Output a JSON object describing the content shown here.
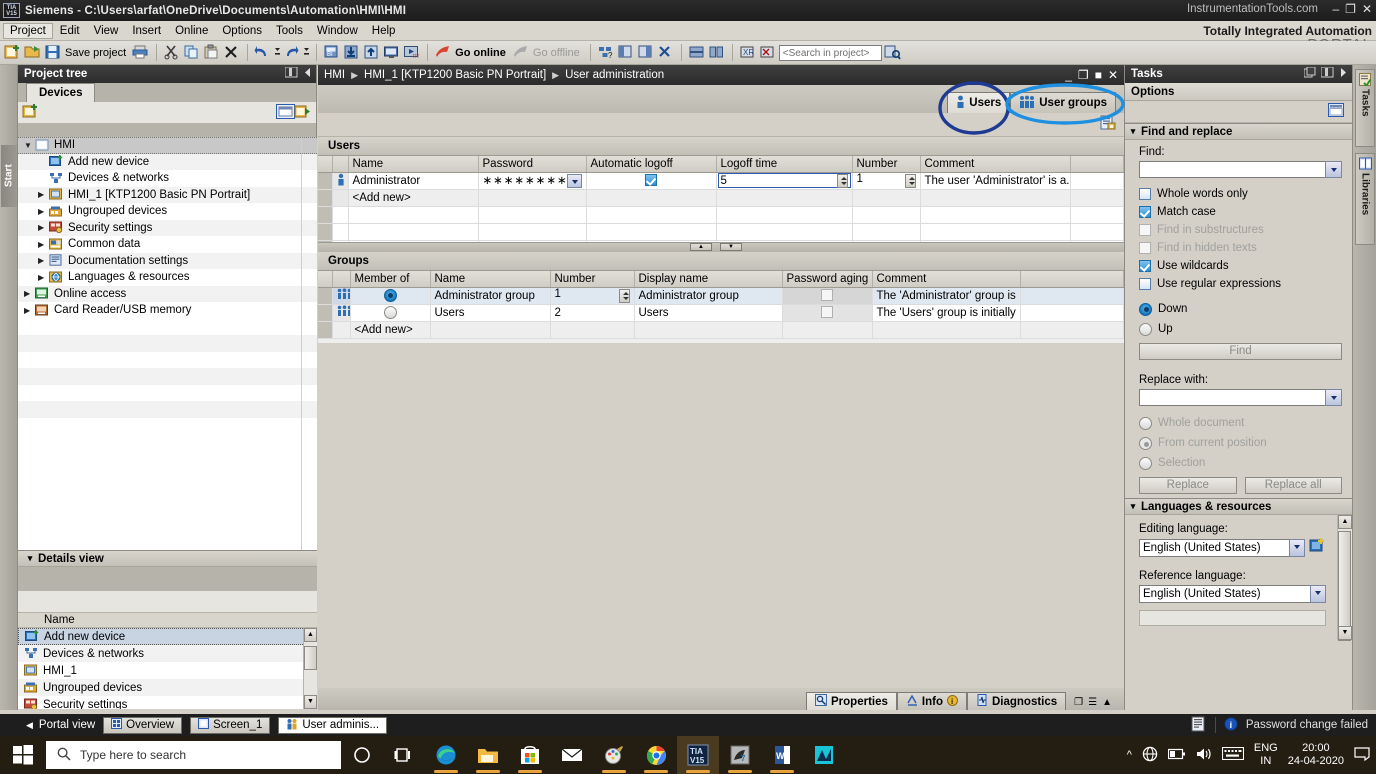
{
  "titlebar": {
    "app_title": "Siemens  -  C:\\Users\\arfat\\OneDrive\\Documents\\Automation\\HMI\\HMI",
    "watermark": "InstrumentationTools.com",
    "minimize": "–",
    "restore": "❐",
    "close": "✕"
  },
  "menu": {
    "items": [
      "Project",
      "Edit",
      "View",
      "Insert",
      "Online",
      "Options",
      "Tools",
      "Window",
      "Help"
    ]
  },
  "branding": {
    "line1": "Totally Integrated Automation",
    "line2": "PORTAL"
  },
  "toolbar": {
    "save_project": "Save project",
    "go_online": "Go online",
    "go_offline": "Go offline",
    "search_placeholder": "<Search in project>"
  },
  "left_strip": {
    "start_tab": "Start"
  },
  "project_tree": {
    "title": "Project tree",
    "tab": "Devices",
    "nodes": [
      {
        "label": "HMI",
        "indent": 0,
        "arrow": "open",
        "icon": "folder-icon",
        "selected": true
      },
      {
        "label": "Add new device",
        "indent": 1,
        "arrow": "none",
        "icon": "add-device-icon",
        "selected": false
      },
      {
        "label": "Devices & networks",
        "indent": 1,
        "arrow": "none",
        "icon": "network-icon",
        "selected": false
      },
      {
        "label": "HMI_1 [KTP1200 Basic PN Portrait]",
        "indent": 1,
        "arrow": "closed",
        "icon": "hmi-device-icon",
        "selected": false
      },
      {
        "label": "Ungrouped devices",
        "indent": 1,
        "arrow": "closed",
        "icon": "ungrouped-icon",
        "selected": false
      },
      {
        "label": "Security settings",
        "indent": 1,
        "arrow": "closed",
        "icon": "security-icon",
        "selected": false
      },
      {
        "label": "Common data",
        "indent": 1,
        "arrow": "closed",
        "icon": "common-data-icon",
        "selected": false
      },
      {
        "label": "Documentation settings",
        "indent": 1,
        "arrow": "closed",
        "icon": "documentation-icon",
        "selected": false
      },
      {
        "label": "Languages & resources",
        "indent": 1,
        "arrow": "closed",
        "icon": "languages-icon",
        "selected": false
      },
      {
        "label": "Online access",
        "indent": 0,
        "arrow": "closed",
        "icon": "online-access-icon",
        "selected": false
      },
      {
        "label": "Card Reader/USB memory",
        "indent": 0,
        "arrow": "closed",
        "icon": "card-reader-icon",
        "selected": false
      }
    ]
  },
  "details_view": {
    "title": "Details view",
    "column_header": "Name",
    "rows": [
      {
        "label": "Add new device",
        "icon": "add-device-icon",
        "selected": true
      },
      {
        "label": "Devices & networks",
        "icon": "network-icon",
        "selected": false
      },
      {
        "label": "HMI_1",
        "icon": "hmi-device-icon",
        "selected": false
      },
      {
        "label": "Ungrouped devices",
        "icon": "ungrouped-icon",
        "selected": false
      },
      {
        "label": "Security settings",
        "icon": "security-icon",
        "selected": false
      }
    ]
  },
  "editor": {
    "breadcrumb": [
      "HMI",
      "HMI_1 [KTP1200 Basic PN Portrait]",
      "User administration"
    ],
    "tabs": [
      {
        "label": "Users",
        "icon": "single-user-icon",
        "active": true
      },
      {
        "label": "User groups",
        "icon": "group-users-icon",
        "active": false
      }
    ],
    "users_section": {
      "title": "Users",
      "columns": [
        "Name",
        "Password",
        "Automatic logoff",
        "Logoff time",
        "Number",
        "Comment"
      ],
      "rows": [
        {
          "name": "Administrator",
          "password": "∗∗∗∗∗∗∗∗",
          "automatic_logoff": true,
          "logoff_time": "5",
          "number": "1",
          "comment": "The user 'Administrator' is a..."
        }
      ],
      "add_new": "<Add new>"
    },
    "groups_section": {
      "title": "Groups",
      "columns": [
        "Member of",
        "Name",
        "Number",
        "Display name",
        "Password aging",
        "Comment"
      ],
      "rows": [
        {
          "member_of": true,
          "name": "Administrator group",
          "number": "1",
          "display_name": "Administrator group",
          "password_aging": false,
          "comment": "The 'Administrator' group is ..."
        },
        {
          "member_of": false,
          "name": "Users",
          "number": "2",
          "display_name": "Users",
          "password_aging": false,
          "comment": "The 'Users' group is initially ..."
        }
      ],
      "add_new": "<Add new>"
    },
    "bottom_tabs": [
      {
        "label": "Properties",
        "icon": "properties-icon",
        "active": true
      },
      {
        "label": "Info",
        "icon": "info-icon",
        "active": false,
        "badge": "i"
      },
      {
        "label": "Diagnostics",
        "icon": "diagnostics-icon",
        "active": false
      }
    ]
  },
  "tasks": {
    "title": "Tasks",
    "options_header": "Options",
    "find_and_replace": {
      "section_title": "Find and replace",
      "find_label": "Find:",
      "find_value": "",
      "checkboxes": [
        {
          "label": "Whole words only",
          "checked": false,
          "enabled": true
        },
        {
          "label": "Match case",
          "checked": true,
          "enabled": true
        },
        {
          "label": "Find in substructures",
          "checked": false,
          "enabled": false
        },
        {
          "label": "Find in hidden texts",
          "checked": false,
          "enabled": false
        },
        {
          "label": "Use wildcards",
          "checked": true,
          "enabled": true
        },
        {
          "label": "Use regular expressions",
          "checked": false,
          "enabled": true
        }
      ],
      "direction": [
        {
          "label": "Down",
          "selected": true
        },
        {
          "label": "Up",
          "selected": false
        }
      ],
      "find_button": "Find",
      "replace_label": "Replace with:",
      "replace_value": "",
      "scope": [
        {
          "label": "Whole document",
          "selected": false
        },
        {
          "label": "From current position",
          "selected": true
        },
        {
          "label": "Selection",
          "selected": false
        }
      ],
      "replace_button": "Replace",
      "replace_all_button": "Replace all"
    },
    "languages_resources": {
      "section_title": "Languages & resources",
      "editing_language_label": "Editing language:",
      "editing_language_value": "English (United States)",
      "reference_language_label": "Reference language:",
      "reference_language_value": "English (United States)"
    },
    "side_tabs": [
      {
        "label": "Tasks",
        "icon": "tasks-icon"
      },
      {
        "label": "Libraries",
        "icon": "libraries-icon"
      }
    ]
  },
  "portal_bar": {
    "portal_view": "Portal view",
    "open_tabs": [
      {
        "label": "Overview",
        "icon": "overview-icon",
        "active": false
      },
      {
        "label": "Screen_1",
        "icon": "screen-icon",
        "active": false
      },
      {
        "label": "User adminis...",
        "icon": "user-admin-icon",
        "active": true
      }
    ],
    "status_message": "Password change failed"
  },
  "taskbar": {
    "search_placeholder": "Type here to search",
    "icons": [
      "cortana-icon",
      "task-view-icon",
      "edge-icon",
      "file-explorer-icon",
      "microsoft-store-icon",
      "mail-icon",
      "paint-icon",
      "chrome-icon",
      "tia-portal-v15-icon",
      "pdf-reader-icon",
      "word-icon",
      "tia-editor-icon"
    ],
    "tray": {
      "language": "ENG",
      "region": "IN",
      "time": "20:00",
      "date": "24-04-2020"
    }
  },
  "annotations": {
    "users_circle_color": "#1f3a93",
    "user_groups_circle_color": "#1f8fe0"
  }
}
